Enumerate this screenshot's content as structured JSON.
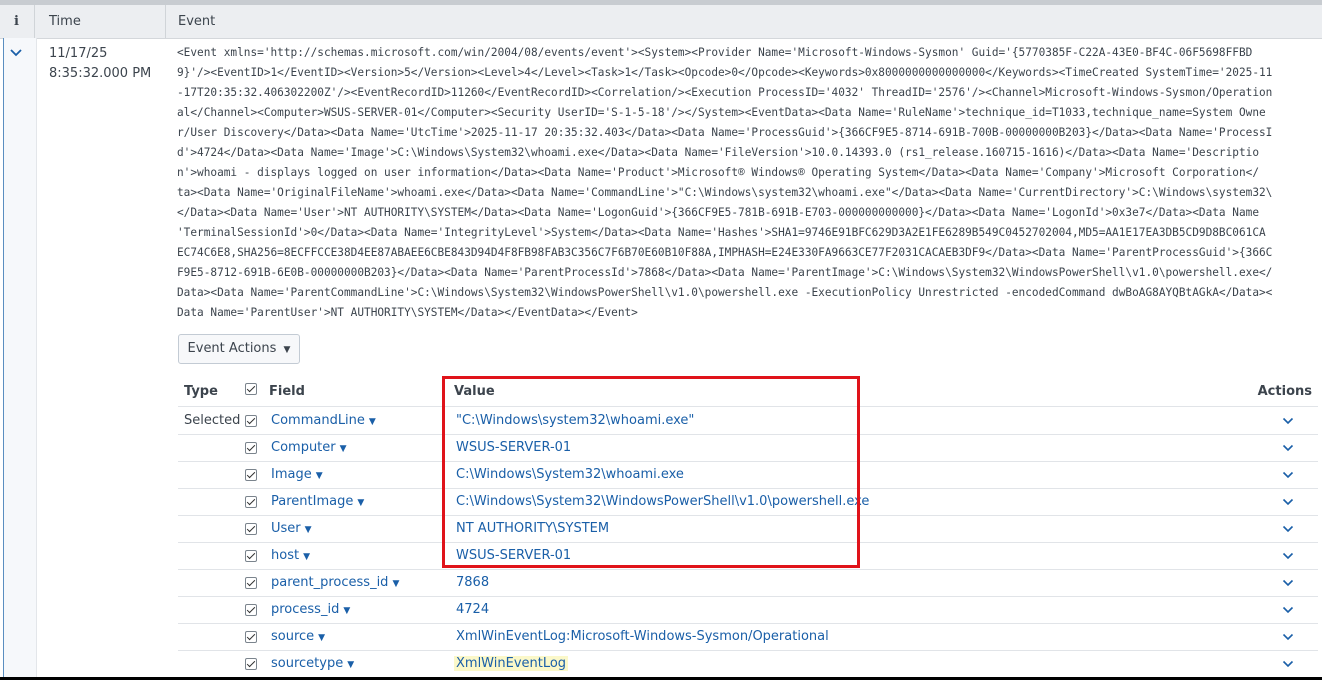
{
  "header": {
    "info_label": "i",
    "time_label": "Time",
    "event_label": "Event"
  },
  "event": {
    "date": "11/17/25",
    "time": "8:35:32.000 PM",
    "raw_lines": [
      "<Event xmlns='http://schemas.microsoft.com/win/2004/08/events/event'><System><Provider Name='Microsoft-Windows-Sysmon' Guid='{5770385F-C22A-43E0-BF4C-06F5698FFBD",
      "9}'/><EventID>1</EventID><Version>5</Version><Level>4</Level><Task>1</Task><Opcode>0</Opcode><Keywords>0x8000000000000000</Keywords><TimeCreated SystemTime='2025-11",
      "-17T20:35:32.406302200Z'/><EventRecordID>11260</EventRecordID><Correlation/><Execution ProcessID='4032' ThreadID='2576'/><Channel>Microsoft-Windows-Sysmon/Operation",
      "al</Channel><Computer>WSUS-SERVER-01</Computer><Security UserID='S-1-5-18'/></System><EventData><Data Name='RuleName'>technique_id=T1033,technique_name=System Owne",
      "r/User Discovery</Data><Data Name='UtcTime'>2025-11-17 20:35:32.403</Data><Data Name='ProcessGuid'>{366CF9E5-8714-691B-700B-00000000B203}</Data><Data Name='ProcessI",
      "d'>4724</Data><Data Name='Image'>C:\\Windows\\System32\\whoami.exe</Data><Data Name='FileVersion'>10.0.14393.0 (rs1_release.160715-1616)</Data><Data Name='Descriptio",
      "n'>whoami - displays logged on user information</Data><Data Name='Product'>Microsoft® Windows® Operating System</Data><Data Name='Company'>Microsoft Corporation</",
      "ta><Data Name='OriginalFileName'>whoami.exe</Data><Data Name='CommandLine'>\"C:\\Windows\\system32\\whoami.exe\"</Data><Data Name='CurrentDirectory'>C:\\Windows\\system32\\",
      "</Data><Data Name='User'>NT AUTHORITY\\SYSTEM</Data><Data Name='LogonGuid'>{366CF9E5-781B-691B-E703-000000000000}</Data><Data Name='LogonId'>0x3e7</Data><Data Name",
      "'TerminalSessionId'>0</Data><Data Name='IntegrityLevel'>System</Data><Data Name='Hashes'>SHA1=9746E91BFC629D3A2E1FE6289B549C0452702004,MD5=AA1E17EA3DB5CD9D8BC061CA",
      "EC74C6E8,SHA256=8ECFFCCE38D4EE87ABAEE6CBE843D94D4F8FB98FAB3C356C7F6B70E60B10F88A,IMPHASH=E24E330FA9663CE77F2031CACAEB3DF9</Data><Data Name='ParentProcessGuid'>{366C",
      "F9E5-8712-691B-6E0B-00000000B203}</Data><Data Name='ParentProcessId'>7868</Data><Data Name='ParentImage'>C:\\Windows\\System32\\WindowsPowerShell\\v1.0\\powershell.exe</",
      "Data><Data Name='ParentCommandLine'>C:\\Windows\\System32\\WindowsPowerShell\\v1.0\\powershell.exe -ExecutionPolicy Unrestricted -encodedCommand dwBoAG8AYQBtAGkA</Data><",
      "Data Name='ParentUser'>NT AUTHORITY\\SYSTEM</Data></EventData></Event>"
    ],
    "actions_button": "Event Actions"
  },
  "fields_table": {
    "headers": {
      "type": "Type",
      "field": "Field",
      "value": "Value",
      "actions": "Actions"
    },
    "selected_label": "Selected",
    "rows": [
      {
        "field": "CommandLine",
        "value": "\"C:\\Windows\\system32\\whoami.exe\""
      },
      {
        "field": "Computer",
        "value": "WSUS-SERVER-01"
      },
      {
        "field": "Image",
        "value": "C:\\Windows\\System32\\whoami.exe"
      },
      {
        "field": "ParentImage",
        "value": "C:\\Windows\\System32\\WindowsPowerShell\\v1.0\\powershell.exe"
      },
      {
        "field": "User",
        "value": "NT AUTHORITY\\SYSTEM"
      },
      {
        "field": "host",
        "value": "WSUS-SERVER-01"
      },
      {
        "field": "parent_process_id",
        "value": "7868"
      },
      {
        "field": "process_id",
        "value": "4724"
      },
      {
        "field": "source",
        "value": "XmlWinEventLog:Microsoft-Windows-Sysmon/Operational"
      },
      {
        "field": "sourcetype",
        "value": "XmlWinEventLog"
      }
    ]
  },
  "colors": {
    "link": "#1a5fa8",
    "highlight_box": "#e0131a",
    "highlight_value_bg": "#fbf8c9"
  }
}
